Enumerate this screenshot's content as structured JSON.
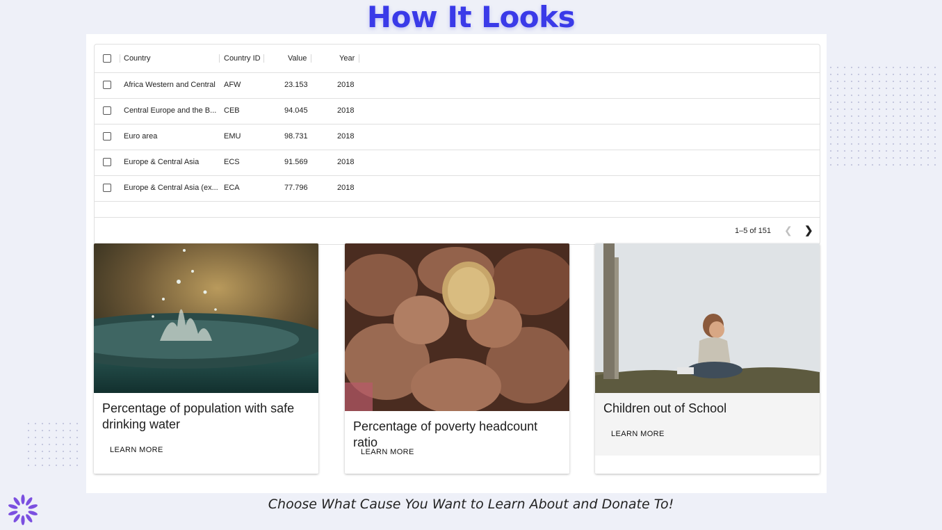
{
  "page": {
    "title": "How It Looks",
    "caption": "Choose What Cause You Want to Learn About and Donate To!"
  },
  "table": {
    "columns": [
      "Country",
      "Country ID",
      "Value",
      "Year"
    ],
    "rows": [
      {
        "country": "Africa Western and Central",
        "id": "AFW",
        "value": "23.153",
        "year": "2018"
      },
      {
        "country": "Central Europe and the B...",
        "id": "CEB",
        "value": "94.045",
        "year": "2018"
      },
      {
        "country": "Euro area",
        "id": "EMU",
        "value": "98.731",
        "year": "2018"
      },
      {
        "country": "Europe & Central Asia",
        "id": "ECS",
        "value": "91.569",
        "year": "2018"
      },
      {
        "country": "Europe & Central Asia (ex...",
        "id": "ECA",
        "value": "77.796",
        "year": "2018"
      }
    ],
    "pagination": "1–5 of 151",
    "prev_icon": "chevron-left-icon",
    "next_icon": "chevron-right-icon"
  },
  "cards": [
    {
      "title": "Percentage of population with safe drinking water",
      "button": "LEARN MORE",
      "image": "water-splash-photo"
    },
    {
      "title": "Percentage of poverty headcount ratio",
      "button": "LEARN MORE",
      "image": "hands-with-grain-photo"
    },
    {
      "title": "Children out of School",
      "button": "LEARN MORE",
      "image": "child-sitting-photo"
    }
  ],
  "colors": {
    "title": "#3a3ae8",
    "background": "#eef0f8",
    "logo": "#7b4fe0"
  }
}
